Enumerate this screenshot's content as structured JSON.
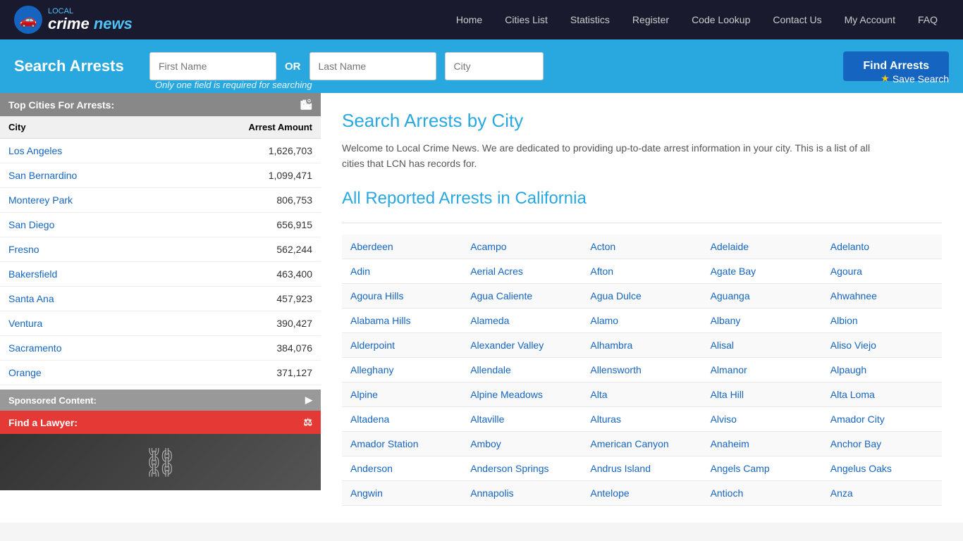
{
  "nav": {
    "logo": {
      "local": "LOCAL",
      "crime": "crime",
      "news": "news"
    },
    "links": [
      {
        "label": "Home",
        "href": "#"
      },
      {
        "label": "Cities List",
        "href": "#"
      },
      {
        "label": "Statistics",
        "href": "#"
      },
      {
        "label": "Register",
        "href": "#"
      },
      {
        "label": "Code Lookup",
        "href": "#"
      },
      {
        "label": "Contact Us",
        "href": "#"
      },
      {
        "label": "My Account",
        "href": "#"
      },
      {
        "label": "FAQ",
        "href": "#"
      }
    ]
  },
  "searchBar": {
    "title": "Search Arrests",
    "firstName": {
      "placeholder": "First Name"
    },
    "or": "OR",
    "lastName": {
      "placeholder": "Last Name"
    },
    "city": {
      "placeholder": "City"
    },
    "hint": "Only one field is required for searching",
    "findButton": "Find Arrests",
    "saveButton": "Save Search"
  },
  "sidebar": {
    "topCitiesHeader": "Top Cities For Arrests:",
    "columns": {
      "city": "City",
      "arrestAmount": "Arrest Amount"
    },
    "cities": [
      {
        "name": "Los Angeles",
        "amount": "1,626,703"
      },
      {
        "name": "San Bernardino",
        "amount": "1,099,471"
      },
      {
        "name": "Monterey Park",
        "amount": "806,753"
      },
      {
        "name": "San Diego",
        "amount": "656,915"
      },
      {
        "name": "Fresno",
        "amount": "562,244"
      },
      {
        "name": "Bakersfield",
        "amount": "463,400"
      },
      {
        "name": "Santa Ana",
        "amount": "457,923"
      },
      {
        "name": "Ventura",
        "amount": "390,427"
      },
      {
        "name": "Sacramento",
        "amount": "384,076"
      },
      {
        "name": "Orange",
        "amount": "371,127"
      }
    ],
    "sponsoredHeader": "Sponsored Content:",
    "lawyerBanner": "Find a Lawyer:"
  },
  "content": {
    "title": "Search Arrests by City",
    "description": "Welcome to Local Crime News. We are dedicated to providing up-to-date arrest information in your city. This is a list of all cities that LCN has records for.",
    "allArrestsTitle": "All Reported Arrests in California",
    "cities": [
      [
        "Aberdeen",
        "Acampo",
        "Acton",
        "Adelaide",
        "Adelanto"
      ],
      [
        "Adin",
        "Aerial Acres",
        "Afton",
        "Agate Bay",
        "Agoura"
      ],
      [
        "Agoura Hills",
        "Agua Caliente",
        "Agua Dulce",
        "Aguanga",
        "Ahwahnee"
      ],
      [
        "Alabama Hills",
        "Alameda",
        "Alamo",
        "Albany",
        "Albion"
      ],
      [
        "Alderpoint",
        "Alexander Valley",
        "Alhambra",
        "Alisal",
        "Aliso Viejo"
      ],
      [
        "Alleghany",
        "Allendale",
        "Allensworth",
        "Almanor",
        "Alpaugh"
      ],
      [
        "Alpine",
        "Alpine Meadows",
        "Alta",
        "Alta Hill",
        "Alta Loma"
      ],
      [
        "Altadena",
        "Altaville",
        "Alturas",
        "Alviso",
        "Amador City"
      ],
      [
        "Amador Station",
        "Amboy",
        "American Canyon",
        "Anaheim",
        "Anchor Bay"
      ],
      [
        "Anderson",
        "Anderson Springs",
        "Andrus Island",
        "Angels Camp",
        "Angelus Oaks"
      ],
      [
        "Angwin",
        "Annapolis",
        "Antelope",
        "Antioch",
        "Anza"
      ]
    ]
  }
}
